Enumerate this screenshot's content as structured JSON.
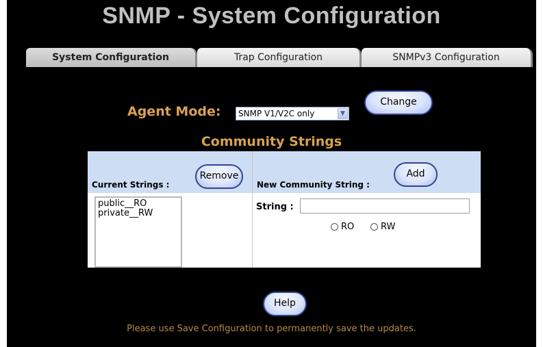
{
  "page": {
    "title": "SNMP - System Configuration"
  },
  "tabs": [
    {
      "label": "System Configuration",
      "active": true
    },
    {
      "label": "Trap Configuration",
      "active": false
    },
    {
      "label": "SNMPv3 Configuration",
      "active": false
    }
  ],
  "agent_mode": {
    "label": "Agent Mode:",
    "selected": "SNMP V1/V2C only",
    "change_label": "Change"
  },
  "community": {
    "title": "Community Strings",
    "current_label": "Current Strings :",
    "remove_label": "Remove",
    "current_strings": [
      "public__RO",
      "private__RW"
    ],
    "new_label": "New Community String :",
    "add_label": "Add",
    "string_label": "String :",
    "string_value": "",
    "radio_ro": "RO",
    "radio_rw": "RW"
  },
  "footer": {
    "help_label": "Help",
    "note": "Please use Save Configuration to permanently save the updates."
  },
  "colors": {
    "background": "#000000",
    "title": "#c0c0c0",
    "accent_label": "#d9a250",
    "table_header": "#cdddf4",
    "button_border": "#33448f"
  },
  "icons": {
    "select_arrow": "chevron-down-icon"
  }
}
